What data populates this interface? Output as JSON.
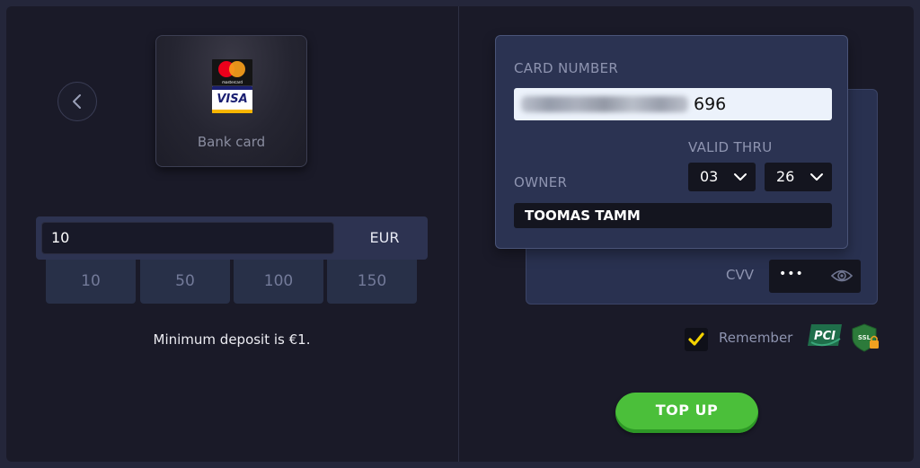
{
  "payment_method": {
    "label": "Bank card",
    "logos": [
      "mastercard",
      "visa"
    ],
    "mastercard_text": "mastercard",
    "visa_text": "VISA"
  },
  "amount": {
    "value": "10",
    "currency": "EUR",
    "presets": [
      "10",
      "50",
      "100",
      "150"
    ]
  },
  "min_deposit_text": "Minimum deposit is €1.",
  "card": {
    "number_label": "CARD NUMBER",
    "number_visible_tail": "696",
    "valid_thru_label": "VALID THRU",
    "month": "03",
    "year": "26",
    "owner_label": "OWNER",
    "owner_value": "TOOMAS TAMM",
    "cvv_label": "CVV",
    "cvv_mask": "•••"
  },
  "remember_label": "Remember",
  "badges": {
    "pci": "PCI",
    "ssl": "SSL"
  },
  "submit_label": "TOP UP",
  "colors": {
    "accent_green": "#4bbf3a",
    "check_yellow": "#f5d300",
    "background": "#1a1a28"
  },
  "icons": [
    "chevron-left-icon",
    "chevron-down-icon",
    "eye-icon",
    "check-icon",
    "pci-badge",
    "ssl-lock-badge"
  ]
}
